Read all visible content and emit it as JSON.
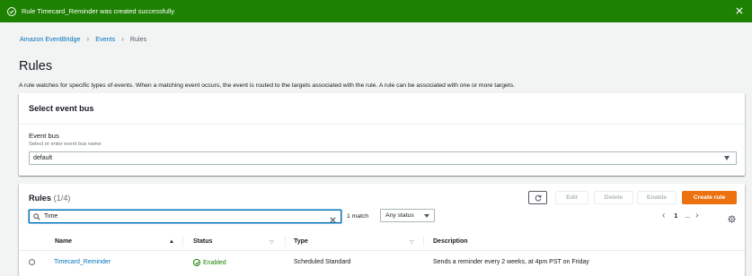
{
  "flash": {
    "message": "Rule Timecard_Reminder was created successfully",
    "color": "#1d8102"
  },
  "breadcrumb": {
    "items": [
      "Amazon EventBridge",
      "Events",
      "Rules"
    ]
  },
  "page": {
    "title": "Rules",
    "description": "A rule watches for specific types of events. When a matching event occurs, the event is routed to the targets associated with the rule. A rule can be associated with one or more targets."
  },
  "event_bus_panel": {
    "header": "Select event bus",
    "label": "Event bus",
    "description": "Select or enter event bus name",
    "selected": "default"
  },
  "rules_panel": {
    "title": "Rules",
    "count": "(1/4)",
    "buttons": {
      "edit": "Edit",
      "delete": "Delete",
      "enable": "Enable",
      "create": "Create rule"
    },
    "search": {
      "value": "Time"
    },
    "match_count": "1 match",
    "status_filter": "Any status",
    "pagination": {
      "current": "1",
      "ellipsis": "..."
    },
    "columns": [
      "Name",
      "Status",
      "Type",
      "Description"
    ],
    "rows": [
      {
        "name": "Timecard_Reminder",
        "status": "Enabled",
        "type": "Scheduled Standard",
        "description": "Sends a reminder every 2 weeks, at 4pm PST on Friday"
      }
    ]
  },
  "colors": {
    "accent_link": "#0073bb",
    "primary_button": "#ec7211",
    "success": "#1d8102"
  }
}
